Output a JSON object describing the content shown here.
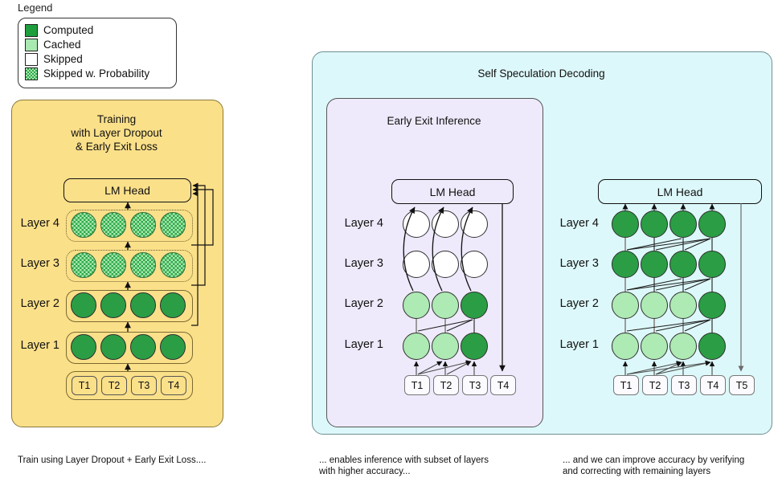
{
  "legend": {
    "title": "Legend",
    "items": [
      {
        "label": "Computed",
        "swatch": "computed-swatch",
        "color": "#1e9e3c"
      },
      {
        "label": "Cached",
        "swatch": "cached-swatch",
        "color": "#a9e8b0"
      },
      {
        "label": "Skipped",
        "swatch": "skipped-swatch",
        "color": "#ffffff"
      },
      {
        "label": "Skipped w. Probability",
        "swatch": "skipped-probability-swatch",
        "color": "#2ea84a"
      }
    ]
  },
  "training": {
    "title_line1": "Training",
    "title_line2": "with Layer Dropout",
    "title_line3": "& Early Exit Loss",
    "lm_head": "LM Head",
    "layers": [
      {
        "name": "Layer 4",
        "state": "skipped-with-probability",
        "nodes": 4
      },
      {
        "name": "Layer 3",
        "state": "skipped-with-probability",
        "nodes": 4
      },
      {
        "name": "Layer 2",
        "state": "computed",
        "nodes": 4
      },
      {
        "name": "Layer 1",
        "state": "computed",
        "nodes": 4
      }
    ],
    "tokens": [
      "T1",
      "T2",
      "T3",
      "T4"
    ],
    "caption": "Train using Layer Dropout + Early Exit Loss...."
  },
  "self_speculation": {
    "title": "Self Speculation Decoding",
    "early_exit": {
      "title": "Early Exit Inference",
      "lm_head": "LM Head",
      "layers": [
        {
          "name": "Layer 4",
          "states": [
            "skipped",
            "skipped",
            "skipped"
          ]
        },
        {
          "name": "Layer 3",
          "states": [
            "skipped",
            "skipped",
            "skipped"
          ]
        },
        {
          "name": "Layer 2",
          "states": [
            "cached",
            "cached",
            "computed"
          ]
        },
        {
          "name": "Layer 1",
          "states": [
            "cached",
            "cached",
            "computed"
          ]
        }
      ],
      "tokens": [
        "T1",
        "T2",
        "T3",
        "T4"
      ],
      "caption_line1": "... enables inference with subset of layers",
      "caption_line2": "with higher accuracy..."
    },
    "verification": {
      "lm_head": "LM Head",
      "layers": [
        {
          "name": "Layer 4",
          "states": [
            "computed",
            "computed",
            "computed",
            "computed"
          ]
        },
        {
          "name": "Layer 3",
          "states": [
            "computed",
            "computed",
            "computed",
            "computed"
          ]
        },
        {
          "name": "Layer 2",
          "states": [
            "cached",
            "cached",
            "cached",
            "computed"
          ]
        },
        {
          "name": "Layer 1",
          "states": [
            "cached",
            "cached",
            "cached",
            "computed"
          ]
        }
      ],
      "tokens": [
        "T1",
        "T2",
        "T3",
        "T4",
        "T5"
      ],
      "caption_line1": "... and we can improve accuracy by verifying",
      "caption_line2": "and correcting with remaining layers"
    }
  },
  "colors": {
    "computed": "#2b9e45",
    "cached": "#aeeab4",
    "skipped": "#ffffff",
    "training_panel_bg": "#fbe08a",
    "ssd_panel_bg": "#ddf8fa",
    "early_exit_panel_bg": "#eeeafb"
  }
}
